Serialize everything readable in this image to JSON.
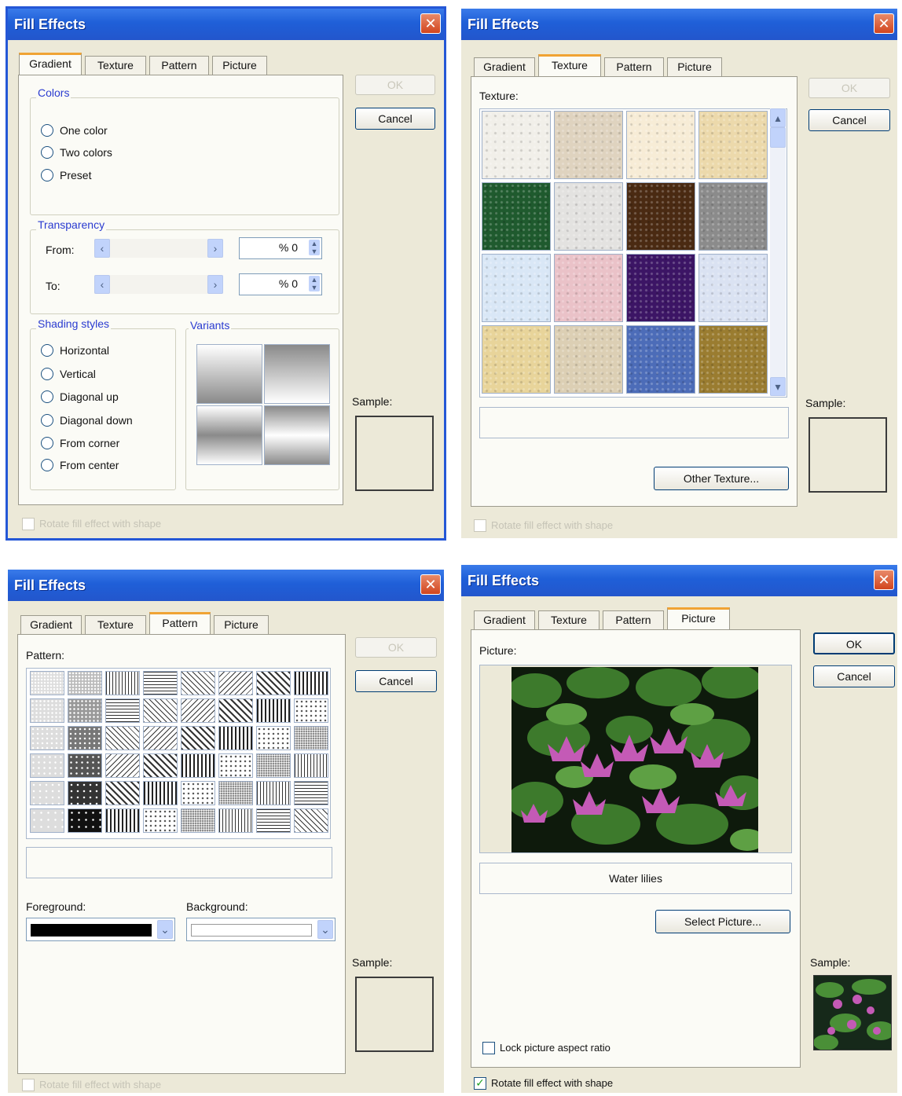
{
  "dialog_title": "Fill Effects",
  "close_glyph": "✕",
  "tabs": [
    "Gradient",
    "Texture",
    "Pattern",
    "Picture"
  ],
  "buttons": {
    "ok": "OK",
    "cancel": "Cancel"
  },
  "sample_label": "Sample:",
  "rotate_label": "Rotate fill effect with shape",
  "gradient": {
    "colors_group": "Colors",
    "color_options": [
      "One color",
      "Two colors",
      "Preset"
    ],
    "transparency_group": "Transparency",
    "from_label": "From:",
    "to_label": "To:",
    "from_value": "% 0",
    "to_value": "% 0",
    "shading_group": "Shading styles",
    "shading_options": [
      "Horizontal",
      "Vertical",
      "Diagonal up",
      "Diagonal down",
      "From corner",
      "From center"
    ],
    "variants_group": "Variants"
  },
  "texture": {
    "texture_label": "Texture:",
    "other_button": "Other Texture...",
    "swatch_colors": [
      "#f1efe9",
      "#dfd3bf",
      "#f7ecd6",
      "#ecd9ab",
      "#1f5a2e",
      "#e3e2e0",
      "#4a2a12",
      "#8b8b8b",
      "#d9e7f6",
      "#eac2c8",
      "#3c1565",
      "#dae2f2",
      "#e8d49a",
      "#dccfb4",
      "#4c6cb8",
      "#9a7c30"
    ]
  },
  "pattern": {
    "pattern_label": "Pattern:",
    "foreground_label": "Foreground:",
    "background_label": "Background:",
    "foreground_color": "#000000",
    "background_color": "#ffffff"
  },
  "picture": {
    "picture_label": "Picture:",
    "picture_name": "Water lilies",
    "select_button": "Select Picture...",
    "lock_label": "Lock picture aspect ratio",
    "rotate_checked": true
  }
}
